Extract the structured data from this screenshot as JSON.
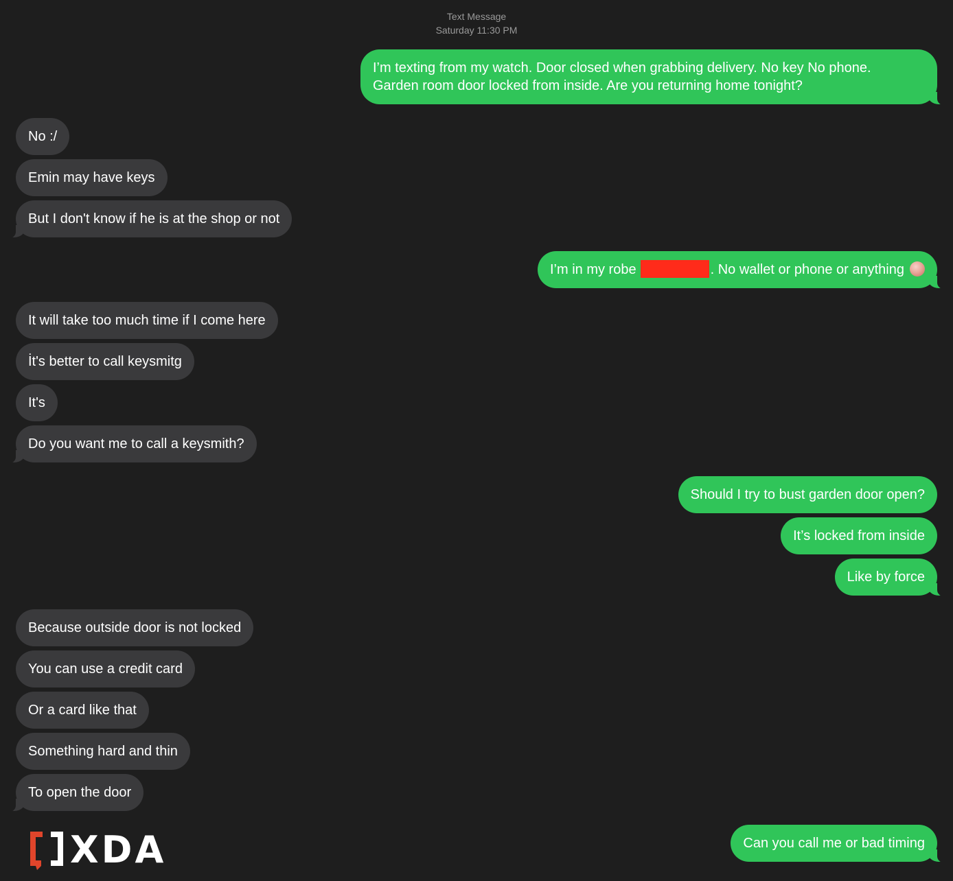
{
  "header": {
    "service": "Text Message",
    "timestamp": "Saturday 11:30 PM"
  },
  "messages": {
    "m1": {
      "text_line1": "I’m texting from my watch. Door closed when grabbing delivery. No key No phone.",
      "text_line2": "Garden room door locked from inside. Are you returning home tonight?"
    },
    "m2": "No :/",
    "m3": "Emin may have keys",
    "m4": "But I don't know if he is at the shop or not",
    "m5": {
      "before": "I’m in my robe",
      "after": ". No wallet or phone or anything"
    },
    "m6": "It will take too much time if I come here",
    "m7": "İt's better to call keysmitg",
    "m8": "It's",
    "m9": "Do you want me to call a keysmith?",
    "m10": "Should I try to bust garden door open?",
    "m11": "It’s locked from inside",
    "m12": "Like by force",
    "m13": "Because outside door is not locked",
    "m14": "You can use a credit card",
    "m15": "Or a card like that",
    "m16": "Something hard and thin",
    "m17": "To open the door",
    "m18": "Can you call me or bad timing"
  },
  "colors": {
    "background": "#1e1e1e",
    "sent_bubble": "#30c559",
    "received_bubble": "#3a3a3c",
    "redaction": "#ff2b1a"
  },
  "logo": {
    "text": "XDA",
    "icon": "xda-bracket-icon"
  }
}
